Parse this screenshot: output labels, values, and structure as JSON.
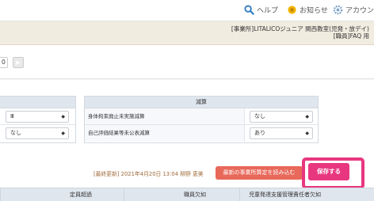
{
  "topnav": {
    "help": "ヘルプ",
    "notice": "お知らせ",
    "account": "アカウント"
  },
  "header": {
    "facility_line1": "[事業所]LITALICOジュニア 関西教室(児発・放デイ)",
    "facility_line2": "[職員]FAQ 用"
  },
  "pager": {
    "page_value": "0",
    "next_symbol": "▶"
  },
  "left_table": {
    "selects": [
      "Ⅲ",
      "なし"
    ]
  },
  "right_table": {
    "header": "減算",
    "rows": [
      {
        "label": "身体拘束廃止未実施減算",
        "value": "なし"
      },
      {
        "label": "自己評価結果等未公表減算",
        "value": "あり"
      }
    ]
  },
  "actions": {
    "last_updated": "[最終更新] 2021年4月20日 13:04 柳野 恵美",
    "load_button": "最新の事業所算定を読み込む",
    "save_button": "保存する"
  },
  "bottom_header": {
    "col1": "定員超過",
    "col2": "職員欠如",
    "col3": "児童発達支援管理責任者欠如"
  },
  "colors": {
    "save": "#e8377f",
    "load": "#e8685a",
    "header_bg": "#f1ece0",
    "table_head": "#dfe6ee"
  }
}
